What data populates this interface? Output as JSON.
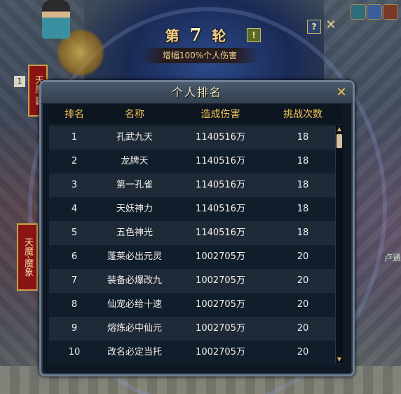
{
  "round": {
    "prefix": "第",
    "number": "7",
    "suffix": "轮",
    "subtitle": "增幅100%个人伤害"
  },
  "top_buttons": {
    "help": "!",
    "question": "?",
    "close": "✕"
  },
  "side": {
    "left_banner_top": "天魔·霸",
    "left_banner": "天魔·魔象",
    "left_counter": "1",
    "right_text": "卢通"
  },
  "panel": {
    "title": "个人排名",
    "close": "✕",
    "headers": {
      "rank": "排名",
      "name": "名称",
      "damage": "造成伤害",
      "count": "挑战次数"
    },
    "rows": [
      {
        "rank": "1",
        "name": "孔武九天",
        "damage": "1140516万",
        "count": "18"
      },
      {
        "rank": "2",
        "name": "龙牌天",
        "damage": "1140516万",
        "count": "18"
      },
      {
        "rank": "3",
        "name": "第一孔雀",
        "damage": "1140516万",
        "count": "18"
      },
      {
        "rank": "4",
        "name": "天妖神力",
        "damage": "1140516万",
        "count": "18"
      },
      {
        "rank": "5",
        "name": "五色神光",
        "damage": "1140516万",
        "count": "18"
      },
      {
        "rank": "6",
        "name": "蓬莱必出元灵",
        "damage": "1002705万",
        "count": "20"
      },
      {
        "rank": "7",
        "name": "装备必爆改九",
        "damage": "1002705万",
        "count": "20"
      },
      {
        "rank": "8",
        "name": "仙宠必给十速",
        "damage": "1002705万",
        "count": "20"
      },
      {
        "rank": "9",
        "name": "熔炼必中仙元",
        "damage": "1002705万",
        "count": "20"
      },
      {
        "rank": "10",
        "name": "改名必定当托",
        "damage": "1002705万",
        "count": "20"
      }
    ]
  },
  "scroll": {
    "up": "▲",
    "down": "▼",
    "position": 0.0
  }
}
